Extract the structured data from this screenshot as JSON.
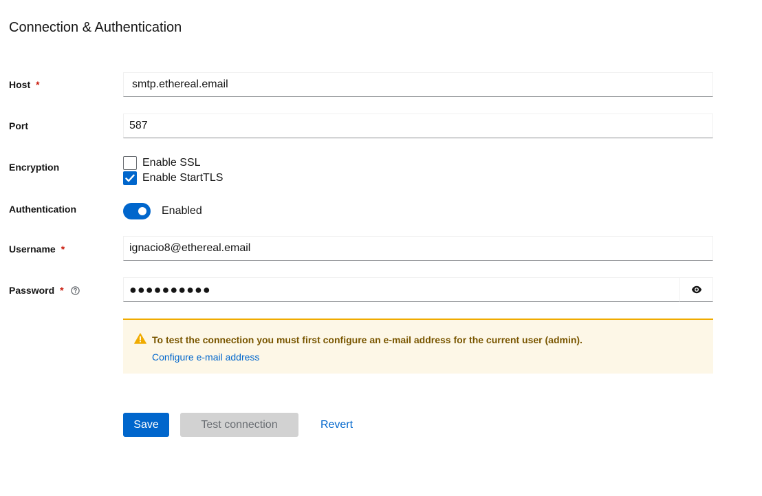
{
  "section": {
    "title": "Connection & Authentication"
  },
  "fields": {
    "host": {
      "label": "Host",
      "required": "*",
      "value": "smtp.ethereal.email"
    },
    "port": {
      "label": "Port",
      "value": "587"
    },
    "encryption": {
      "label": "Encryption",
      "ssl": {
        "label": "Enable SSL",
        "checked": false
      },
      "starttls": {
        "label": "Enable StartTLS",
        "checked": true
      }
    },
    "authentication": {
      "label": "Authentication",
      "state_label": "Enabled",
      "on": true
    },
    "username": {
      "label": "Username",
      "required": "*",
      "value": "ignacio8@ethereal.email"
    },
    "password": {
      "label": "Password",
      "required": "*",
      "masked_value": "●●●●●●●●●●",
      "help_icon": "help-circle-icon",
      "reveal_icon": "eye-icon"
    }
  },
  "alert": {
    "icon": "warning-triangle-icon",
    "title": "To test the connection you must first configure an e-mail address for the current user (admin).",
    "link": "Configure e-mail address"
  },
  "actions": {
    "save": "Save",
    "test": "Test connection",
    "revert": "Revert"
  },
  "colors": {
    "primary": "#0066cc",
    "required": "#c9190b",
    "warning": "#f0ab00",
    "warning_bg": "#fdf7e7",
    "warning_text": "#795600",
    "disabled_bg": "#d2d2d2"
  }
}
